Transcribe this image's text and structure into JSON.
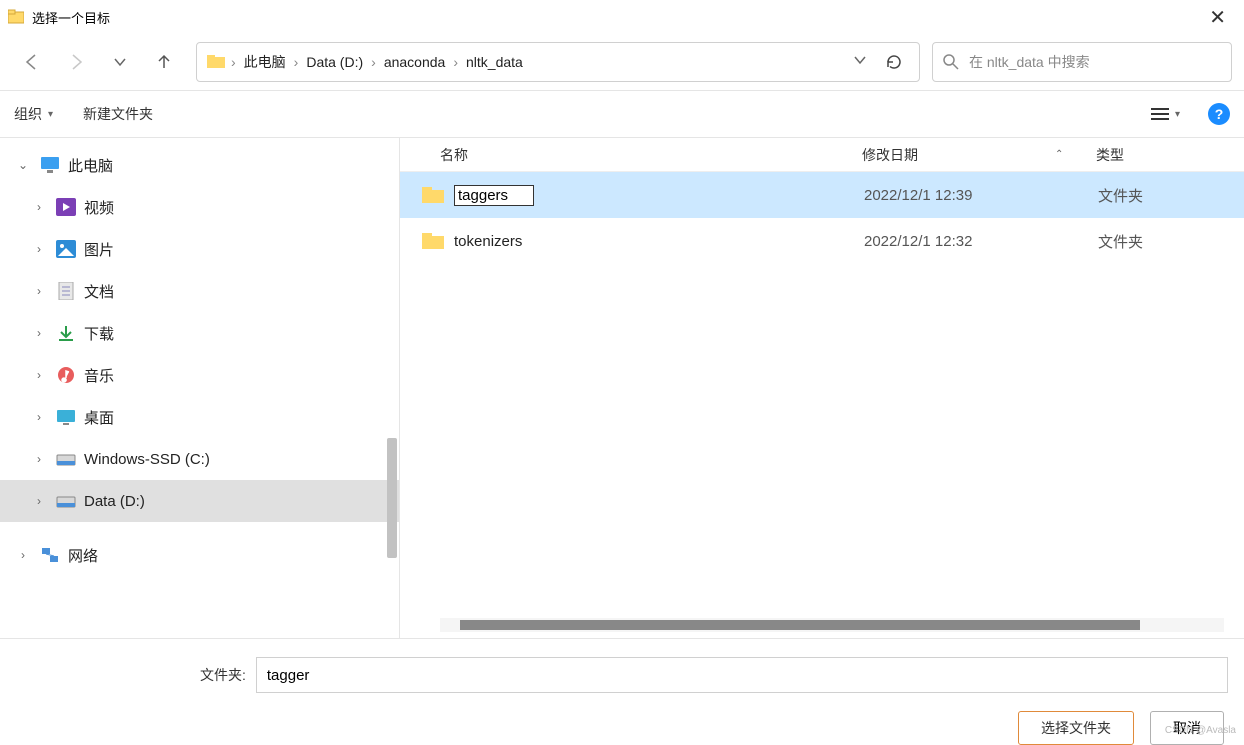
{
  "window": {
    "title": "选择一个目标"
  },
  "breadcrumb": {
    "items": [
      "此电脑",
      "Data (D:)",
      "anaconda",
      "nltk_data"
    ]
  },
  "search": {
    "placeholder": "在 nltk_data 中搜索"
  },
  "toolbar": {
    "organize": "组织",
    "new_folder": "新建文件夹"
  },
  "sidebar": {
    "root": "此电脑",
    "items": [
      {
        "label": "视频",
        "icon": "video"
      },
      {
        "label": "图片",
        "icon": "pictures"
      },
      {
        "label": "文档",
        "icon": "documents"
      },
      {
        "label": "下载",
        "icon": "downloads"
      },
      {
        "label": "音乐",
        "icon": "music"
      },
      {
        "label": "桌面",
        "icon": "desktop"
      },
      {
        "label": "Windows-SSD (C:)",
        "icon": "drive"
      },
      {
        "label": "Data (D:)",
        "icon": "drive",
        "selected": true
      }
    ],
    "network": "网络"
  },
  "columns": {
    "name": "名称",
    "date": "修改日期",
    "type": "类型"
  },
  "rows": [
    {
      "name": "taggers",
      "editing": true,
      "selected": true,
      "date": "2022/12/1 12:39",
      "type": "文件夹"
    },
    {
      "name": "tokenizers",
      "editing": false,
      "selected": false,
      "date": "2022/12/1 12:32",
      "type": "文件夹"
    }
  ],
  "footer": {
    "label": "文件夹:",
    "value": "tagger",
    "select_btn": "选择文件夹",
    "cancel_btn": "取消"
  },
  "watermark": "CSDN @Avasla"
}
